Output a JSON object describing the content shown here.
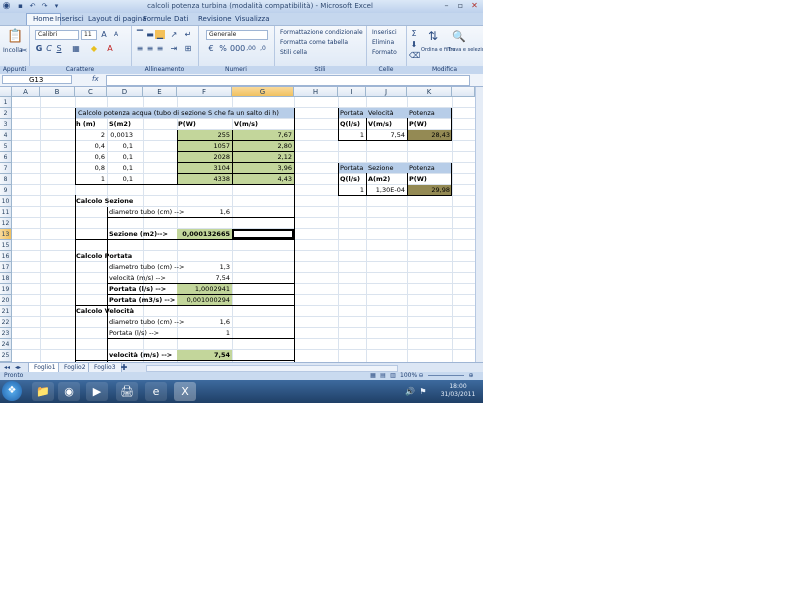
{
  "window": {
    "title": "calcoli potenza turbina (modalità compatibilità) - Microsoft Excel"
  },
  "tabs": [
    "Home",
    "Inserisci",
    "Layout di pagina",
    "Formule",
    "Dati",
    "Revisione",
    "Visualizza"
  ],
  "ribbon": {
    "groups": {
      "clipboard": "Appunti",
      "font": "Carattere",
      "alignment": "Allineamento",
      "number": "Numeri",
      "styles": "Stili",
      "cells": "Celle",
      "editing": "Modifica"
    },
    "paste_label": "Incolla",
    "font_name": "Calibri",
    "font_size": "11",
    "number_format": "Generale",
    "conditional_format": "Formattazione condizionale",
    "format_as_table": "Formatta come tabella",
    "cell_styles": "Stili cella",
    "insert": "Inserisci",
    "delete": "Elimina",
    "format": "Formato",
    "sort_filter": "Ordina e filtra",
    "find_select": "Trova e seleziona"
  },
  "formula_bar": {
    "name_box": "G13",
    "fx": "fx",
    "value": ""
  },
  "columns": [
    "A",
    "B",
    "C",
    "D",
    "E",
    "F",
    "G",
    "H",
    "I",
    "J",
    "K"
  ],
  "rows": [
    "1",
    "2",
    "3",
    "4",
    "5",
    "6",
    "7",
    "8",
    "9",
    "10",
    "11",
    "12",
    "13",
    "15",
    "16",
    "17",
    "18",
    "19",
    "20",
    "21",
    "22",
    "23",
    "24",
    "25"
  ],
  "sheet": {
    "title_banner": "Calcolo potenza acqua (tubo di sezione S che fa un salto di h)",
    "hdr_h": "h (m)",
    "hdr_s": "S(m2)",
    "hdr_p": "P(W)",
    "hdr_v": "V(m/s)",
    "table": [
      {
        "h": "2",
        "s": "0,0013",
        "p": "255",
        "v": "7,67"
      },
      {
        "h": "0,4",
        "s": "0,1",
        "p": "1057",
        "v": "2,80"
      },
      {
        "h": "0,6",
        "s": "0,1",
        "p": "2028",
        "v": "2,12"
      },
      {
        "h": "0,8",
        "s": "0,1",
        "p": "3104",
        "v": "3,96"
      },
      {
        "h": "1",
        "s": "0,1",
        "p": "4338",
        "v": "4,43"
      }
    ],
    "calc_sezione": "Calcolo Sezione",
    "diametro_label": "diametro tubo (cm) -->",
    "diametro_value": "1,6",
    "sezione_label": "Sezione (m2)-->",
    "sezione_value": "0,000132665",
    "calc_portata": "Calcolo Portata",
    "p_diametro_label": "diametro tubo (cm) -->",
    "p_diametro_value": "1,3",
    "p_velocita_label": "velocità (m/s) -->",
    "p_velocita_value": "7,54",
    "portata_ls_label": "Portata (l/s) -->",
    "portata_ls_value": "1,0002941",
    "portata_m3s_label": "Portata (m3/s) -->",
    "portata_m3s_value": "0,001000294",
    "calc_velocita": "Calcolo Velocità",
    "v_diametro_label": "diametro tubo (cm) -->",
    "v_diametro_value": "1,6",
    "v_portata_label": "Portata (l/s) -->",
    "v_portata_value": "1",
    "velocita_label": "velocità (m/s) -->",
    "velocita_value": "7,54",
    "right1": {
      "portata": "Portata",
      "velocita": "Velocità",
      "potenza": "Potenza",
      "q": "Q(l/s)",
      "v": "V(m/s)",
      "p": "P(W)",
      "q_val": "1",
      "v_val": "7,54",
      "p_val": "28,43"
    },
    "right2": {
      "portata": "Portata",
      "sezione": "Sezione",
      "potenza": "Potenza",
      "q": "Q(l/s)",
      "a": "A(m2)",
      "p": "P(W)",
      "q_val": "1",
      "a_val": "1,30E-04",
      "p_val": "29,98"
    }
  },
  "sheet_tabs": [
    "Foglio1",
    "Foglio2",
    "Foglio3"
  ],
  "status": {
    "ready": "Pronto",
    "zoom": "100%"
  },
  "taskbar": {
    "time": "18:00",
    "date": "31/03/2011"
  }
}
